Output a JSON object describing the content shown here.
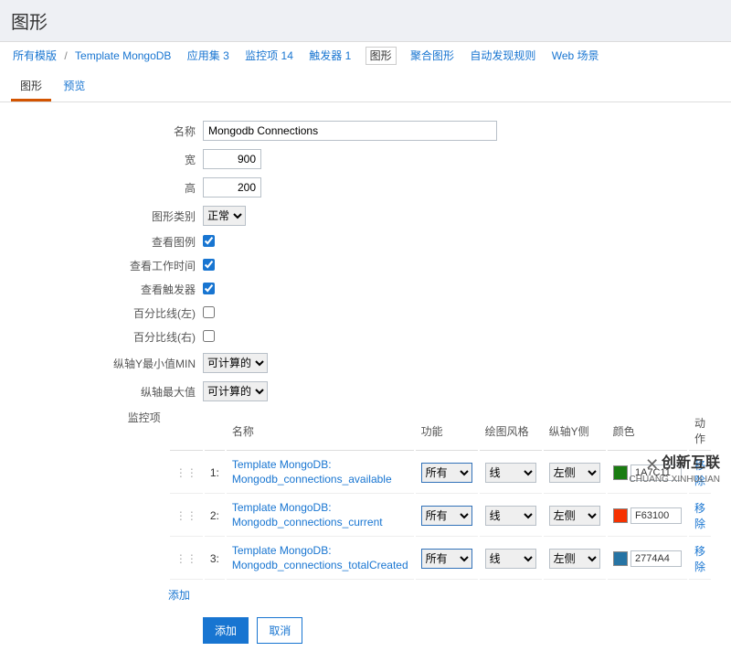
{
  "header": {
    "title": "图形"
  },
  "breadcrumb": {
    "all_templates": "所有模版",
    "template": "Template MongoDB",
    "apps": {
      "label": "应用集",
      "count": 3
    },
    "items": {
      "label": "监控项",
      "count": 14
    },
    "triggers": {
      "label": "触发器",
      "count": 1
    },
    "graphs": "图形",
    "screens": "聚合图形",
    "discovery": "自动发现规则",
    "web": "Web 场景"
  },
  "tabs": {
    "graph": "图形",
    "preview": "预览"
  },
  "form": {
    "name_label": "名称",
    "name_value": "Mongodb Connections",
    "width_label": "宽",
    "width_value": "900",
    "height_label": "高",
    "height_value": "200",
    "type_label": "图形类别",
    "type_value": "正常",
    "legend_label": "查看图例",
    "legend_checked": true,
    "worktime_label": "查看工作时间",
    "worktime_checked": true,
    "triggers_label": "查看触发器",
    "triggers_checked": true,
    "left_pct_label": "百分比线(左)",
    "left_pct_checked": false,
    "right_pct_label": "百分比线(右)",
    "right_pct_checked": false,
    "ymin_label": "纵轴Y最小值MIN",
    "ymin_value": "可计算的",
    "ymax_label": "纵轴最大值",
    "ymax_value": "可计算的",
    "item_label": "监控项",
    "cols": {
      "name": "名称",
      "func": "功能",
      "style": "绘图风格",
      "yside": "纵轴Y侧",
      "color": "颜色",
      "action": "动作"
    },
    "delete_link": "移除",
    "add_link": "添加",
    "item_tmpl": "Template MongoDB:",
    "fn_value": "所有",
    "style_value": "线",
    "yside_value": "左侧",
    "rows": [
      {
        "n": "1:",
        "key": "Mongodb_connections_available",
        "color": "1A7C11",
        "hex": "#1A7C11"
      },
      {
        "n": "2:",
        "key": "Mongodb_connections_current",
        "color": "F63100",
        "hex": "#F63100"
      },
      {
        "n": "3:",
        "key": "Mongodb_connections_totalCreated",
        "color": "2774A4",
        "hex": "#2774A4"
      }
    ]
  },
  "buttons": {
    "add": "添加",
    "cancel": "取消"
  },
  "logo": {
    "line1": "创新互联",
    "line2": "CHUANG XINHULIAN"
  }
}
